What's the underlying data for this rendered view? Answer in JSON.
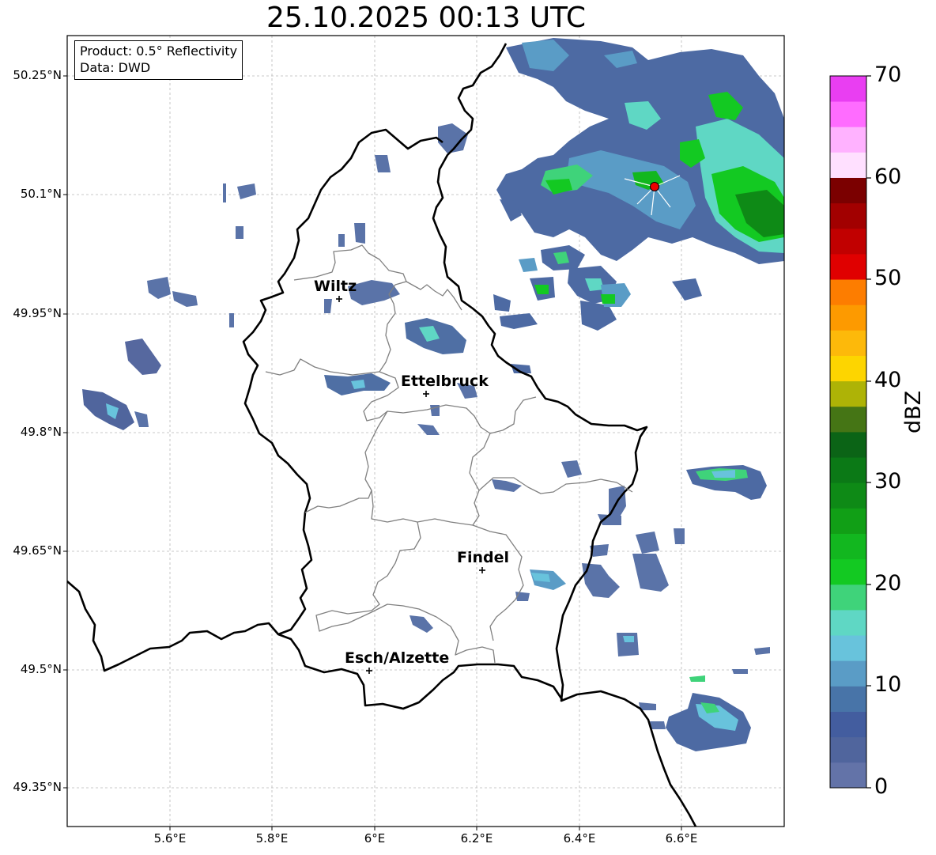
{
  "title": "25.10.2025 00:13 UTC",
  "infobox": {
    "product": "Product: 0.5° Reflectivity",
    "data": "Data: DWD"
  },
  "latitude_labels": [
    "50.25°N",
    "50.1°N",
    "49.95°N",
    "49.8°N",
    "49.65°N",
    "49.5°N",
    "49.35°N"
  ],
  "longitude_labels": [
    "5.6°E",
    "5.8°E",
    "6°E",
    "6.2°E",
    "6.4°E",
    "6.6°E"
  ],
  "cities": [
    {
      "name": "Wiltz"
    },
    {
      "name": "Ettelbruck"
    },
    {
      "name": "Findel"
    },
    {
      "name": "Esch/Alzette"
    }
  ],
  "radar_site_marker": "red-dot",
  "colorbar": {
    "label": "dBZ",
    "ticks": [
      "0",
      "10",
      "20",
      "30",
      "40",
      "50",
      "60",
      "70"
    ],
    "range": [
      0,
      70
    ],
    "bin_colors": [
      "#6373a8",
      "#50659d",
      "#435d9f",
      "#4874a8",
      "#5a9cc6",
      "#68c3dc",
      "#5fd7c4",
      "#3fd37a",
      "#13c922",
      "#12b71f",
      "#119f16",
      "#0e8a16",
      "#0b7916",
      "#0b6416",
      "#457515",
      "#aeb306",
      "#fdd500",
      "#fdb90a",
      "#fd9a00",
      "#fd7d00",
      "#e00000",
      "#c10000",
      "#a20000",
      "#7b0000",
      "#ffe0ff",
      "#ffb2ff",
      "#ff6cff",
      "#e93ef2"
    ]
  }
}
